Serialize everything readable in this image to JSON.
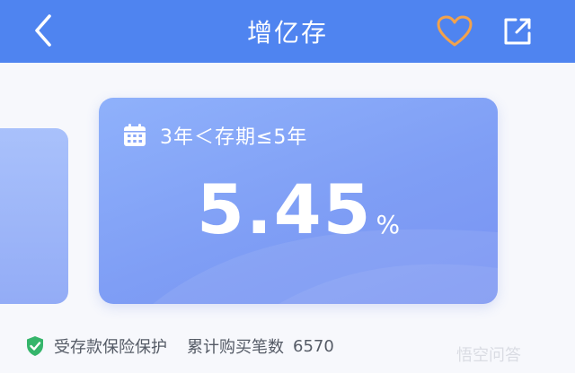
{
  "header": {
    "title": "增亿存",
    "back_icon": "chevron-left-icon",
    "favorite_icon": "heart-outline-icon",
    "share_icon": "share-out-icon",
    "background_color": "#4f84f0",
    "favorite_color": "#f3a24b"
  },
  "product_card": {
    "term_icon": "calendar-icon",
    "term_label": "3年＜存期≤5年",
    "rate_value": "5.45",
    "rate_unit": "%"
  },
  "footer": {
    "insurance_icon": "shield-check-icon",
    "insurance_text": "受存款保险保护",
    "purchase_count_label": "累计购买笔数",
    "purchase_count": "6570"
  },
  "watermark": {
    "text": "悟空问答"
  }
}
